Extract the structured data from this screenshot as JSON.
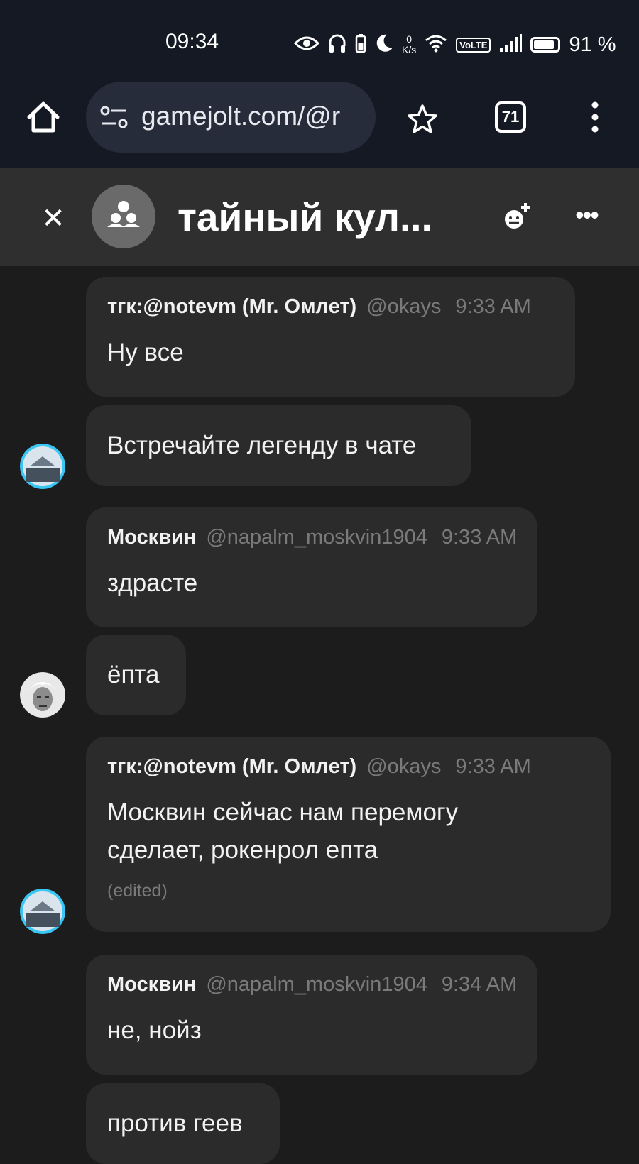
{
  "status_bar": {
    "time": "09:34",
    "net_speed_value": "0",
    "net_speed_unit": "K/s",
    "volte": "VoLTE",
    "battery": "91 %",
    "icons": [
      "eye-icon",
      "headphones-icon",
      "battery-saver-icon",
      "moon-icon",
      "wifi-icon",
      "volte-icon",
      "signal-icon",
      "battery-icon"
    ]
  },
  "browser": {
    "url": "gamejolt.com/@r",
    "tab_count": "71",
    "icons": [
      "home-icon",
      "tune-icon",
      "star-icon",
      "tabs-icon",
      "menu-icon"
    ]
  },
  "chat_header": {
    "close": "✕",
    "title": "тайный кул...",
    "more": "•••",
    "icons": [
      "close-icon",
      "group-icon",
      "add-member-icon",
      "more-icon"
    ]
  },
  "messages": [
    {
      "author": "тгк:@notevm (Mr. Омлет)",
      "handle": "@okays",
      "time": "9:33 AM",
      "text": "Ну все"
    },
    {
      "text": "Встречайте легенду в чате"
    },
    {
      "author": "Москвин",
      "handle": "@napalm_moskvin1904",
      "time": "9:33 AM",
      "text": "здрасте"
    },
    {
      "text": "ёпта"
    },
    {
      "author": "тгк:@notevm (Mr. Омлет)",
      "handle": "@okays",
      "time": "9:33 AM",
      "text_line1": "Москвин сейчас нам перемогу",
      "text_line2": "сделает, рокенрол епта",
      "edited": "(edited)"
    },
    {
      "author": "Москвин",
      "handle": "@napalm_moskvin1904",
      "time": "9:34 AM",
      "text": "не, нойз"
    },
    {
      "text": "против геев"
    }
  ],
  "colors": {
    "browser_bg": "#141924",
    "omnibox_bg": "#262c3a",
    "header_bg": "#2f2f2f",
    "chat_bg": "#1c1c1c",
    "bubble_bg": "#2b2b2b",
    "muted_text": "#7a7a7a",
    "avatar_ring": "#39c6f4"
  }
}
